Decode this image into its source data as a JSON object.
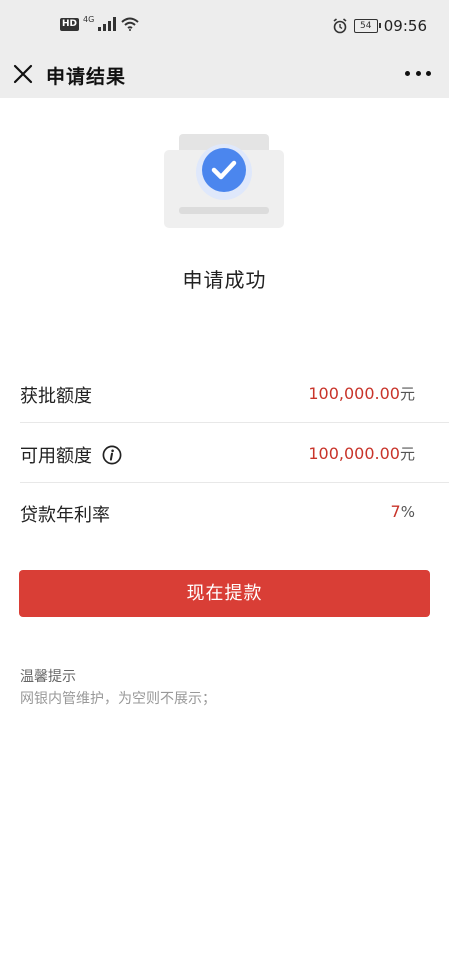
{
  "status_bar": {
    "hd_label": "HD",
    "network_label": "4G",
    "battery_level": "54",
    "time": "09:56"
  },
  "nav": {
    "title": "申请结果"
  },
  "result": {
    "status_text": "申请成功"
  },
  "details": [
    {
      "label": "获批额度",
      "value": "100,000.00",
      "unit": "元"
    },
    {
      "label": "可用额度",
      "value": "100,000.00",
      "unit": "元"
    },
    {
      "label": "贷款年利率",
      "value": "7",
      "unit": "%"
    }
  ],
  "actions": {
    "withdraw_label": "现在提款"
  },
  "tips": {
    "title": "温馨提示",
    "text": "网银内管维护，为空则不展示；"
  },
  "colors": {
    "accent": "#d93e36",
    "value_red": "#c8342a",
    "check_blue": "#4b86ee",
    "topbar_bg": "#ededed"
  }
}
